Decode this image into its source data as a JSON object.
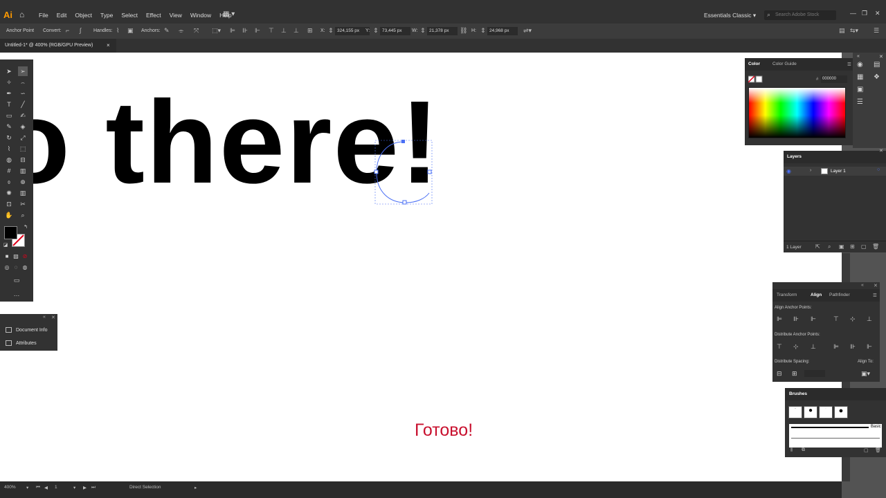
{
  "app": {
    "logo": "Ai",
    "menus": [
      "File",
      "Edit",
      "Object",
      "Type",
      "Select",
      "Effect",
      "View",
      "Window",
      "Help"
    ],
    "workspace": "Essentials Classic",
    "search_placeholder": "Search Adobe Stock"
  },
  "control_bar": {
    "tool_label": "Anchor Point",
    "convert_label": "Convert:",
    "handles_label": "Handles:",
    "anchors_label": "Anchors:",
    "x_label": "X:",
    "x_value": "324,155 px",
    "y_label": "Y:",
    "y_value": "73,445 px",
    "w_label": "W:",
    "w_value": "21,378 px",
    "h_label": "H:",
    "h_value": "24,968 px"
  },
  "document_tab": {
    "title": "Untitled-1* @ 400% (RGB/GPU Preview)",
    "close": "×"
  },
  "canvas": {
    "art_text": "lo there!",
    "caption": "Готово!"
  },
  "status_bar": {
    "zoom": "400%",
    "artboard": "1",
    "tool": "Direct Selection"
  },
  "doc_panel": {
    "items": [
      "Document Info",
      "Attributes"
    ]
  },
  "color_panel": {
    "tabs": [
      "Color",
      "Color Guide"
    ],
    "hex_prefix": "#",
    "hex_value": "000000"
  },
  "layers_panel": {
    "title": "Layers",
    "layer_name": "Layer 1",
    "footer": "1 Layer"
  },
  "align_panel": {
    "tabs": [
      "Transform",
      "Align",
      "Pathfinder"
    ],
    "align_anchor_points": "Align Anchor Points:",
    "distribute_anchor_points": "Distribute Anchor Points:",
    "distribute_spacing": "Distribute Spacing:",
    "align_to": "Align To:"
  },
  "brushes_panel": {
    "title": "Brushes",
    "basic_label": "Basic"
  },
  "colors": {
    "caption": "#c8102e",
    "logo": "#ff9a00",
    "selection": "#4a6ff5"
  }
}
